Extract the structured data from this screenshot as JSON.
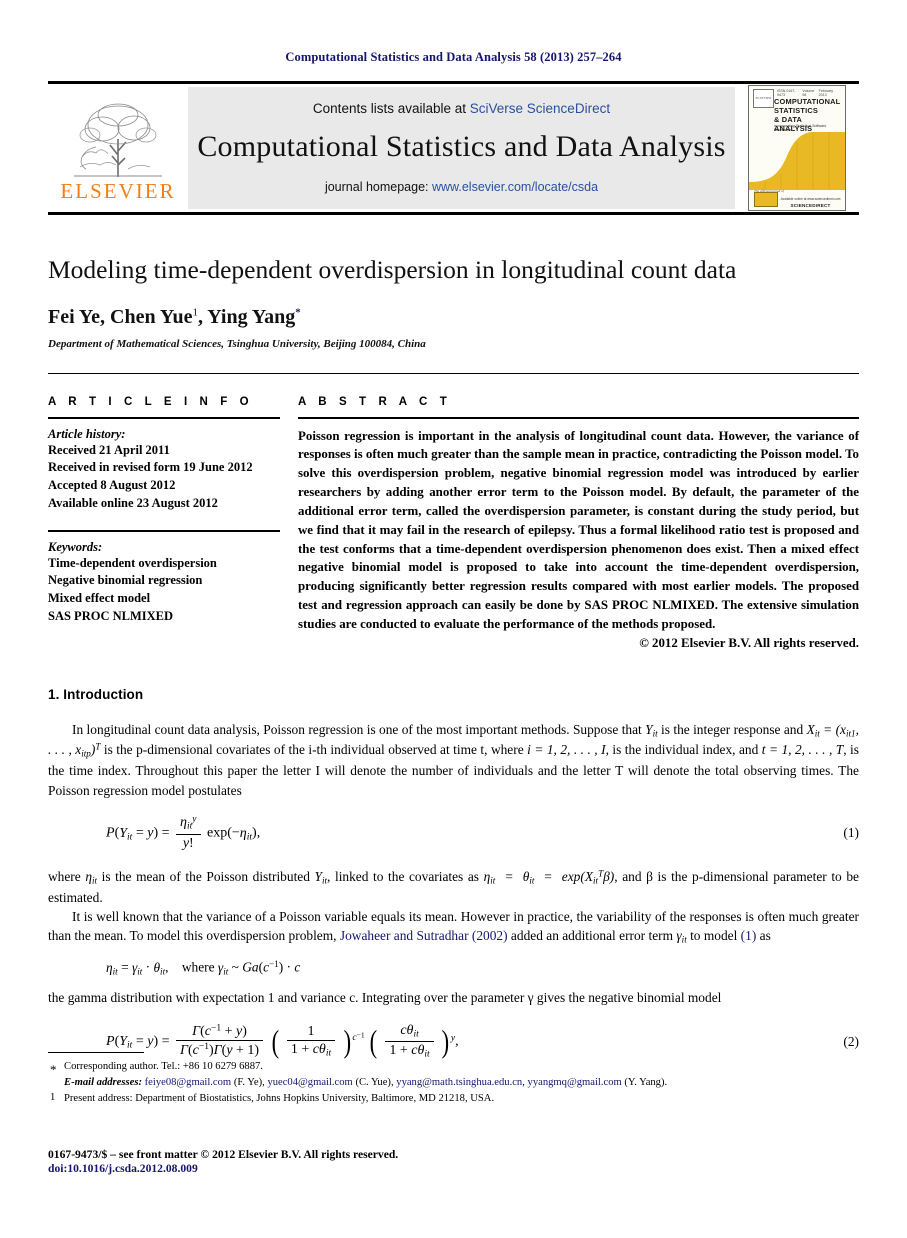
{
  "running_head": "Computational Statistics and Data Analysis 58 (2013) 257–264",
  "masthead": {
    "contents_prefix": "Contents lists available at ",
    "contents_link": "SciVerse ScienceDirect",
    "journal_title": "Computational Statistics and Data Analysis",
    "homepage_prefix": "journal homepage: ",
    "homepage_url": "www.elsevier.com/locate/csda",
    "publisher_wordmark": "ELSEVIER",
    "cover": {
      "elsevier_box": "ELSEVIER",
      "issn_left": "ISSN 0167-9473",
      "issn_center": "Volume 58",
      "issn_right": "February 2013",
      "title_line1": "COMPUTATIONAL",
      "title_line2": "STATISTICS",
      "title_line3": "& DATA ANALYSIS",
      "subtitle": "incorporating Statistical Software Newsletter",
      "official_journal": "The official journal of",
      "availability": "Available online at www.sciencedirect.com",
      "sciencedirect": "SCIENCEDIRECT"
    }
  },
  "paper": {
    "title": "Modeling time-dependent overdispersion in longitudinal count data",
    "authors_text": "Fei Ye, Chen Yue , Ying Yang",
    "author_1": "Fei Ye, Chen Yue",
    "author_footnote_1": "1",
    "author_2": ", Ying Yang",
    "author_star": "*",
    "affiliation": "Department of Mathematical Sciences, Tsinghua University, Beijing 100084, China"
  },
  "article_info": {
    "heading": "A R T I C L E    I N F O",
    "history_label": "Article history:",
    "history": [
      "Received 21 April 2011",
      "Received in revised form 19 June 2012",
      "Accepted 8 August 2012",
      "Available online 23 August 2012"
    ],
    "keywords_label": "Keywords:",
    "keywords": [
      "Time-dependent overdispersion",
      "Negative binomial regression",
      "Mixed effect model",
      "SAS PROC NLMIXED"
    ]
  },
  "abstract": {
    "heading": "A B S T R A C T",
    "text": "Poisson regression is important in the analysis of longitudinal count data. However, the variance of responses is often much greater than the sample mean in practice, contradicting the Poisson model. To solve this overdispersion problem, negative binomial regression model was introduced by earlier researchers by adding another error term to the Poisson model. By default, the parameter of the additional error term, called the overdispersion parameter, is constant during the study period, but we find that it may fail in the research of epilepsy. Thus a formal likelihood ratio test is proposed and the test conforms that a time-dependent overdispersion phenomenon does exist. Then a mixed effect negative binomial model is proposed to take into account the time-dependent overdispersion, producing significantly better regression results compared with most earlier models. The proposed test and regression approach can easily be done by SAS PROC NLMIXED. The extensive simulation studies are conducted to evaluate the performance of the methods proposed.",
    "copyright": "© 2012 Elsevier B.V. All rights reserved."
  },
  "introduction": {
    "heading": "1.  Introduction",
    "p1_a": "In longitudinal count data analysis, Poisson regression is one of the most important methods. Suppose that ",
    "p1_b": " is the integer response and ",
    "p1_c": " is the p-dimensional covariates of the i-th individual observed at time t, where ",
    "p1_d": ", is the individual index, and ",
    "p1_e": ", is the time index. Throughout this paper the letter I will denote the number of individuals and the letter T will denote the total observing times. The Poisson regression model postulates",
    "eq1_number": "(1)",
    "p2_a": "where ",
    "p2_b": " is the mean of the Poisson distributed ",
    "p2_c": ", linked to the covariates as ",
    "p2_d": ", and β is the p-dimensional parameter to be estimated.",
    "p3_a": "It is well known that the variance of a Poisson variable equals its mean. However in practice, the variability of the responses is often much greater than the mean. To model this overdispersion problem, ",
    "p3_cite": "Jowaheer and Sutradhar (2002)",
    "p3_b": " added an additional error term ",
    "p3_c": " to model ",
    "p3_eqref": "(1)",
    "p3_d": " as",
    "p4": "the gamma distribution with expectation 1 and variance c. Integrating over the parameter γ gives the negative binomial model",
    "eq2_number": "(2)"
  },
  "footnotes": {
    "star_mark": "*",
    "star_text": "Corresponding author. Tel.: +86 10 6279 6887.",
    "email_label": "E-mail addresses:",
    "emails": [
      {
        "address": "feiye08@gmail.com",
        "person": " (F. Ye), "
      },
      {
        "address": "yuec04@gmail.com",
        "person": " (C. Yue), "
      },
      {
        "address": "yyang@math.tsinghua.edu.cn",
        "person": ", "
      },
      {
        "address": "yyangmq@gmail.com",
        "person": " (Y. Yang)."
      }
    ],
    "one_mark": "1",
    "one_text": "Present address: Department of Biostatistics, Johns Hopkins University, Baltimore, MD 21218, USA."
  },
  "bottom": {
    "issn_line": "0167-9473/$ – see front matter © 2012 Elsevier B.V. All rights reserved.",
    "doi": "doi:10.1016/j.csda.2012.08.009"
  },
  "colors": {
    "link_blue": "#15166b",
    "sciencedirect_blue": "#2b4f9e",
    "elsevier_orange": "#f07f1a",
    "masthead_gray": "#e9e9e9",
    "cover_gold": "#e8b923"
  }
}
